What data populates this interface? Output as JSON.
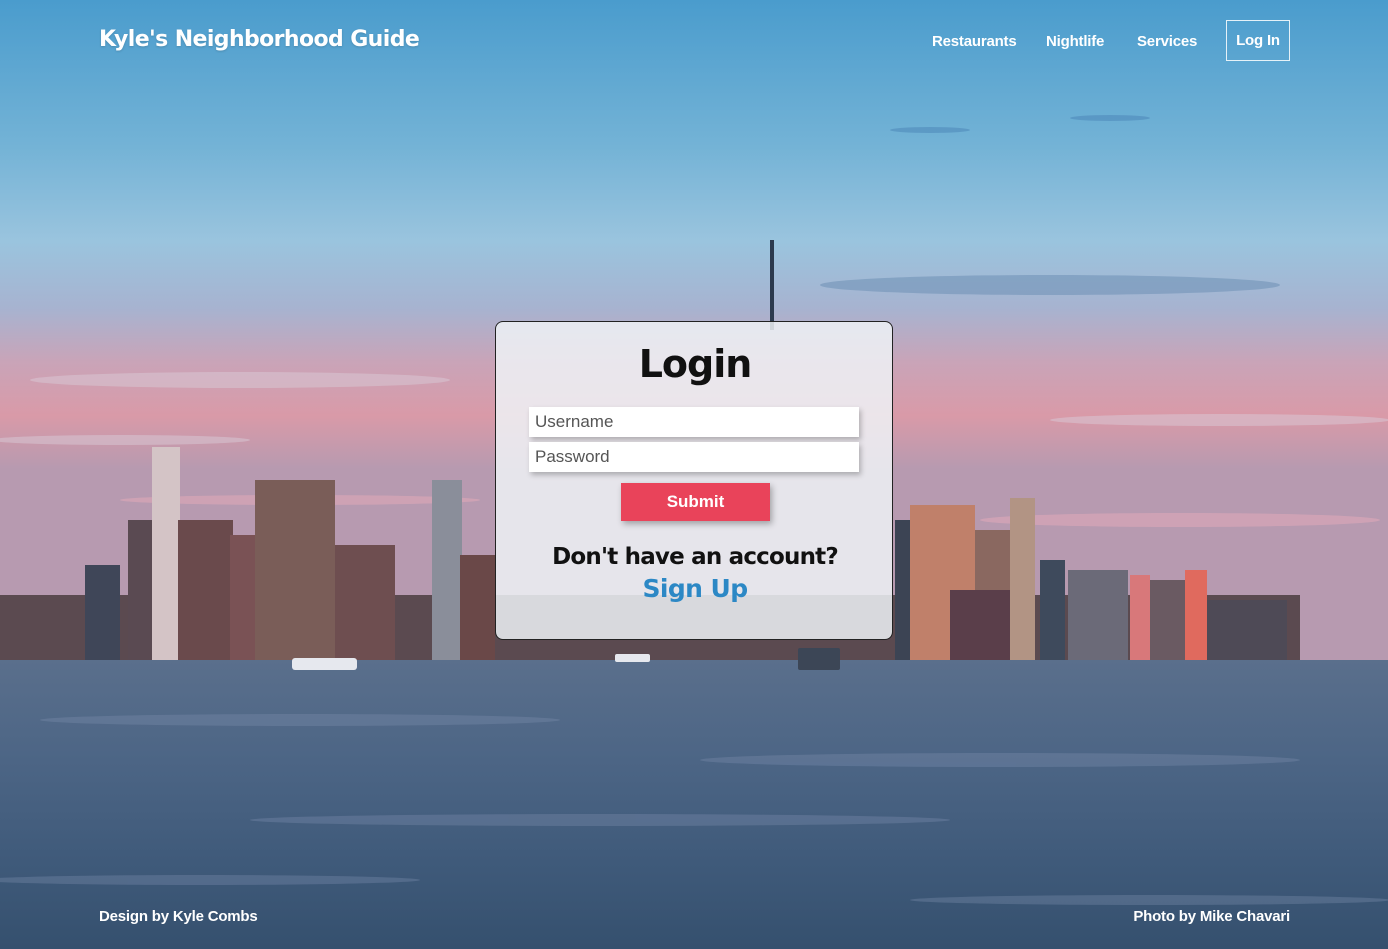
{
  "nav": {
    "brand": "Kyle's Neighborhood Guide",
    "links": [
      "Restaurants",
      "Nightlife",
      "Services"
    ],
    "login_button": "Log In"
  },
  "login_card": {
    "title": "Login",
    "username_placeholder": "Username",
    "password_placeholder": "Password",
    "submit_label": "Submit",
    "prompt": "Don't have an account?",
    "signup_link": "Sign Up"
  },
  "footer": {
    "design_credit": "Design by Kyle Combs",
    "photo_credit": "Photo by Mike Chavari"
  },
  "colors": {
    "submit": "#e9435a",
    "signup_link": "#2c88c5",
    "card_bg": "#eef2f6",
    "text_dark": "#111111"
  }
}
